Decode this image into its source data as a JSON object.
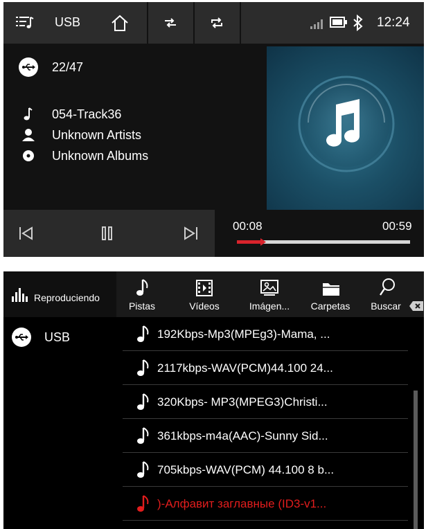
{
  "topbar": {
    "source": "USB",
    "time": "12:24",
    "icons": [
      "playlist-icon",
      "home-icon",
      "shuffle-icon",
      "repeat-icon",
      "signal-icon",
      "battery-icon",
      "bluetooth-icon"
    ]
  },
  "now_playing": {
    "track_count": "22/47",
    "title": "054-Track36",
    "artist": "Unknown Artists",
    "album": "Unknown Albums",
    "elapsed": "00:08",
    "duration": "00:59",
    "progress_fraction": 0.14
  },
  "browser": {
    "now_playing_label": "Reproduciendo",
    "tabs": [
      {
        "label": "Pistas",
        "icon": "music-note-icon"
      },
      {
        "label": "Vídeos",
        "icon": "film-icon"
      },
      {
        "label": "Imágen...",
        "icon": "image-icon"
      },
      {
        "label": "Carpetas",
        "icon": "folder-icon"
      },
      {
        "label": "Buscar",
        "icon": "search-icon"
      }
    ],
    "source_label": "USB",
    "items": [
      {
        "title": "192Kbps-Mp3(MPEg3)-Mama, ..."
      },
      {
        "title": "2117kbps-WAV(PCM)44.100 24..."
      },
      {
        "title": "320Kbps- MP3(MPEG3)Christi..."
      },
      {
        "title": "361kbps-m4a(AAC)-Sunny Sid..."
      },
      {
        "title": "705kbps-WAV(PCM) 44.100 8 b..."
      },
      {
        "title": ")-Алфавит заглавные (ID3-v1...",
        "active": true
      }
    ]
  },
  "colors": {
    "accent": "#e21d1d",
    "progress_track": "#d8d8d8",
    "album_bg": "#1b4f66"
  }
}
